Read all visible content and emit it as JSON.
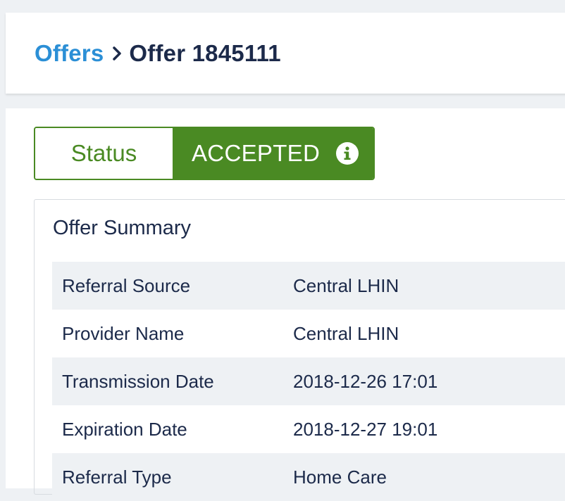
{
  "breadcrumb": {
    "parent": "Offers",
    "current": "Offer 1845111"
  },
  "status": {
    "label": "Status",
    "value": "ACCEPTED"
  },
  "summary": {
    "title": "Offer Summary",
    "rows": [
      {
        "label": "Referral Source",
        "value": "Central LHIN"
      },
      {
        "label": "Provider Name",
        "value": "Central LHIN"
      },
      {
        "label": "Transmission Date",
        "value": "2018-12-26 17:01"
      },
      {
        "label": "Expiration Date",
        "value": "2018-12-27 19:01"
      },
      {
        "label": "Referral Type",
        "value": "Home Care"
      }
    ]
  },
  "colors": {
    "link": "#2b8fd6",
    "status_green": "#4a8a23",
    "text_dark": "#1c2a4a",
    "row_shade": "#eef1f4"
  },
  "icons": [
    "chevron-right-icon",
    "info-icon"
  ]
}
